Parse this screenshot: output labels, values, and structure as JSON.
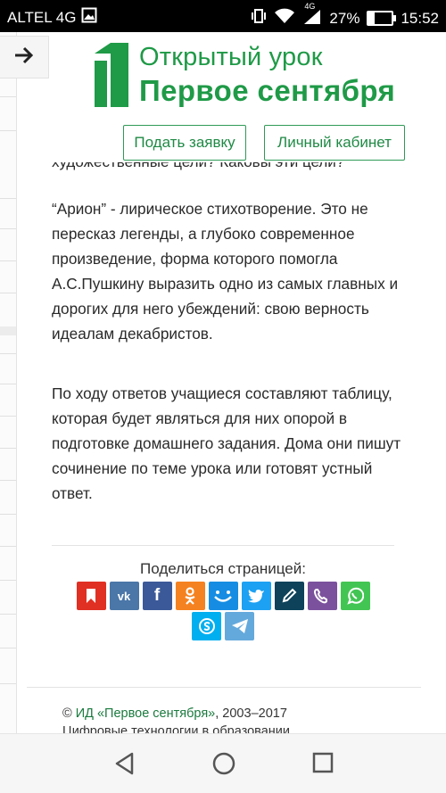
{
  "status_bar": {
    "carrier": "ALTEL 4G",
    "network_badge": "4G",
    "battery_percent": "27%",
    "battery_level": 0.27,
    "time": "15:52",
    "icons": [
      "image-icon",
      "vibrate-icon",
      "wifi-icon",
      "signal-icon",
      "battery-icon"
    ]
  },
  "header": {
    "logo_line1": "Открытый урок",
    "logo_line2": "Первое сентября",
    "apply_button": "Подать заявку",
    "cabinet_button": "Личный кабинет",
    "brand_color": "#1f9a47"
  },
  "article": {
    "cut_line": "художественные цели? Каковы эти цели?",
    "paragraph1": "“Арион” - лирическое стихотворение. Это не пересказ легенды, а глубоко современное произведение, форма которого помогла А.С.Пушкину выразить одно из самых главных и дорогих для него убеждений: свою верность идеалам декабристов.",
    "paragraph2": "По ходу ответов учащиеся составляют таблицу, которая будет являться для них опорой в подготовке домашнего задания. Дома они пишут сочинение по теме урока или готовят устный ответ."
  },
  "share": {
    "label": "Поделиться страницей:",
    "buttons": [
      {
        "name": "bookmark",
        "color": "#e03023"
      },
      {
        "name": "vk",
        "color": "#4a76a8"
      },
      {
        "name": "facebook",
        "color": "#3b5998"
      },
      {
        "name": "odnoklassniki",
        "color": "#f58220"
      },
      {
        "name": "moimir",
        "color": "#168de2"
      },
      {
        "name": "twitter",
        "color": "#1da1f2"
      },
      {
        "name": "livejournal",
        "color": "#0d425a"
      },
      {
        "name": "viber",
        "color": "#7b519d"
      },
      {
        "name": "whatsapp",
        "color": "#43c553"
      },
      {
        "name": "skype",
        "color": "#00aff0"
      },
      {
        "name": "telegram",
        "color": "#64a9dc"
      }
    ]
  },
  "footer": {
    "copyright_symbol": "©",
    "publisher_link": "ИД «Первое сентября»",
    "years": ", 2003–2017",
    "line2": "Цифровые технологии в образовании"
  },
  "navigation": {
    "icons": [
      "back-icon",
      "home-icon",
      "recents-icon"
    ]
  }
}
